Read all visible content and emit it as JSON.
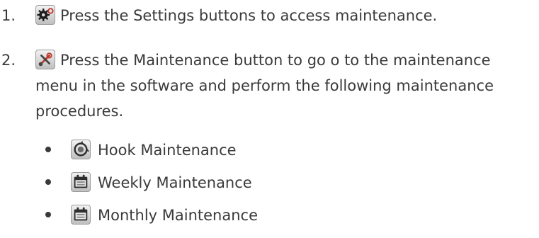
{
  "steps": [
    {
      "number": "1.",
      "icon": "settings-icon",
      "text": "Press the Settings buttons to access maintenance."
    },
    {
      "number": "2.",
      "icon": "maintenance-icon",
      "text": "Press the Maintenance button to go o to the maintenance menu in the software and perform the following maintenance procedures."
    }
  ],
  "procedures": [
    {
      "icon": "hook-maintenance-icon",
      "label": "Hook Maintenance"
    },
    {
      "icon": "weekly-calendar-icon",
      "label": "Weekly Maintenance"
    },
    {
      "icon": "monthly-calendar-icon",
      "label": "Monthly Maintenance"
    }
  ],
  "colors": {
    "text": "#3a3a3a",
    "icon_accent": "#c0392b"
  }
}
